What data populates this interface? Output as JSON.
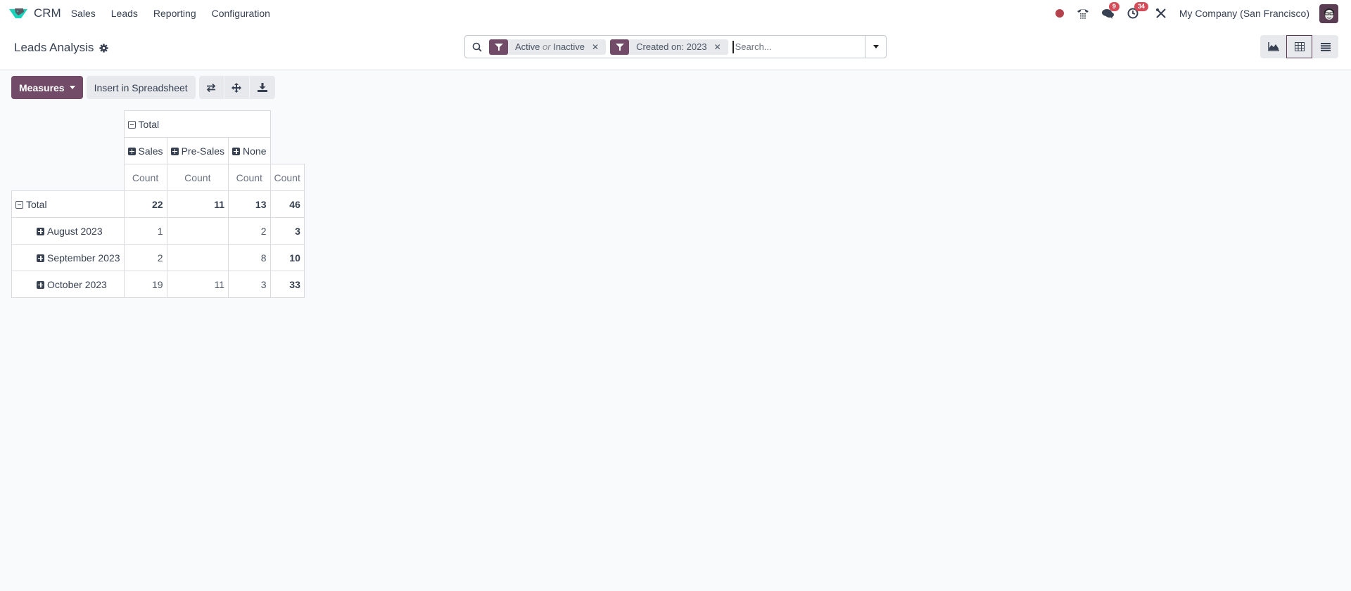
{
  "navbar": {
    "app_name": "CRM",
    "menu": [
      "Sales",
      "Leads",
      "Reporting",
      "Configuration"
    ],
    "messages_badge": "9",
    "activities_badge": "34",
    "company": "My Company (San Francisco)",
    "icons": [
      "record-dot-icon",
      "phone-icon",
      "chat-icon",
      "clock-icon",
      "tools-icon",
      "avatar"
    ]
  },
  "control": {
    "title": "Leads Analysis",
    "facets": [
      {
        "label_a": "Active",
        "label_or": "or",
        "label_b": "Inactive"
      },
      {
        "label": "Created on: 2023"
      }
    ],
    "search_placeholder": "Search...",
    "views": [
      "graph",
      "pivot",
      "list"
    ],
    "active_view": "pivot"
  },
  "toolbar": {
    "measures_label": "Measures",
    "insert_label": "Insert in Spreadsheet"
  },
  "pivot": {
    "col_total_label": "Total",
    "col_groups": [
      "Sales",
      "Pre-Sales",
      "None"
    ],
    "measure_label": "Count",
    "row_total_label": "Total",
    "total_row": [
      "22",
      "11",
      "13",
      "46"
    ],
    "rows": [
      {
        "label": "August 2023",
        "values": [
          "1",
          "",
          "2",
          "3"
        ]
      },
      {
        "label": "September 2023",
        "values": [
          "2",
          "",
          "8",
          "10"
        ]
      },
      {
        "label": "October 2023",
        "values": [
          "19",
          "11",
          "3",
          "33"
        ]
      }
    ]
  },
  "colors": {
    "brand": "#714b67",
    "badge": "#d44c59",
    "logo": "#1ad3bb"
  }
}
